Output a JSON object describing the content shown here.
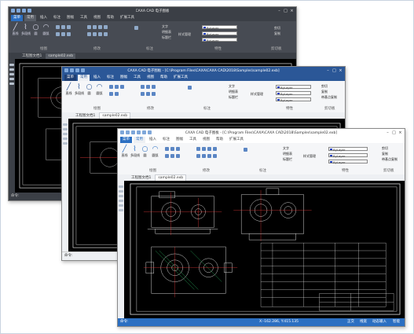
{
  "windows": [
    {
      "title": "CAXA CAD 电子图板",
      "path_title": "",
      "tabs": [
        "菜单",
        "常用",
        "插入",
        "标注",
        "图幅",
        "工具",
        "视图",
        "帮助",
        "扩展工具"
      ],
      "ribbon": {
        "buttons": [
          "直线",
          "多段线",
          "圆",
          "圆弧"
        ],
        "text_items": [
          "文字",
          "明细表",
          "标题栏"
        ],
        "style_label": "样式管理",
        "combos": [
          "ByLayer",
          "ByLayer",
          "ByLayer"
        ],
        "clipboard": [
          "剪切",
          "复制"
        ],
        "groups": [
          "绘图",
          "修改",
          "标注",
          "特性",
          "剪切板"
        ]
      },
      "doc_tabs": [
        "工程图文档1",
        "sample02.exb"
      ],
      "command_label": "命令:",
      "status": {}
    },
    {
      "title": "CAXA CAD 电子图板 - [C:\\Program Files\\CAXA\\CAXA CAD\\2018\\Samples\\sample02.exb]",
      "path_title": "",
      "tabs": [
        "菜单",
        "常用",
        "插入",
        "标注",
        "图幅",
        "工具",
        "视图",
        "帮助",
        "扩展工具"
      ],
      "ribbon": {
        "buttons": [
          "直线",
          "多段线",
          "圆",
          "圆弧"
        ],
        "text_items": [
          "文字",
          "明细表",
          "标题栏"
        ],
        "style_label": "样式管理",
        "combos": [
          "ByLayer",
          "ByLayer",
          "ByLayer"
        ],
        "clipboard": [
          "剪切",
          "复制",
          "带基点复制"
        ],
        "groups": [
          "绘图",
          "修改",
          "标注",
          "特性",
          "剪切板"
        ]
      },
      "doc_tabs": [
        "工程图文档1",
        "sample02.exb"
      ],
      "command_label": "命令:",
      "status": {}
    },
    {
      "title": "CAXA CAD 电子图板 - [C:\\Program Files\\CAXA\\CAXA CAD\\2018\\Samples\\sample02.exb]",
      "path_title": "",
      "tabs": [
        "菜单",
        "常用",
        "插入",
        "标注",
        "图幅",
        "工具",
        "视图",
        "帮助",
        "扩展工具"
      ],
      "ribbon": {
        "buttons": [
          "直线",
          "多段线",
          "圆",
          "圆弧"
        ],
        "text_items": [
          "文字",
          "明细表",
          "标题栏"
        ],
        "style_label": "样式管理",
        "combos": [
          "ByLayer",
          "ByLayer",
          "ByLayer"
        ],
        "clipboard": [
          "剪切",
          "复制",
          "带基点复制"
        ],
        "groups": [
          "绘图",
          "修改",
          "标注",
          "特性",
          "剪切板"
        ]
      },
      "doc_tabs": [
        "工程图文档1",
        "sample02.exb"
      ],
      "command_label": "命令:",
      "status": {
        "hint": "命令:",
        "coords": "X:-162.286, Y:415.135",
        "modes": [
          "正交",
          "线宽",
          "动态输入",
          "智能"
        ]
      }
    }
  ],
  "colors": {
    "dark_title": "#3b3f46",
    "blue_title": "#2b5797",
    "accent": "#2b6fc2",
    "canvas": "#000000",
    "drawing_lines": "#ffffff",
    "drawing_accent": "#ff4040",
    "drawing_green": "#30d070"
  }
}
